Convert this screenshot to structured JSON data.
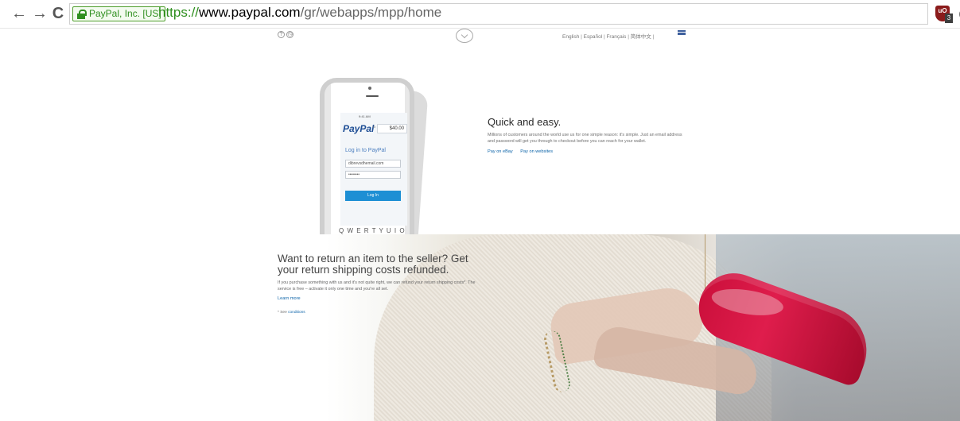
{
  "browser": {
    "back_symbol": "←",
    "forward_symbol": "→",
    "reload_symbol": "C",
    "ev_label": "PayPal, Inc. [US]",
    "url_proto": "https://",
    "url_host": "www.paypal.com",
    "url_path": "/gr/webapps/mpp/home",
    "ublock_label": "uO",
    "ublock_count": "3"
  },
  "top": {
    "help": "?",
    "clock": "◷",
    "languages": [
      "English",
      "Español",
      "Français",
      "简体中文"
    ]
  },
  "phone": {
    "time": "9:41 AM",
    "logo": "PayPal",
    "to": "To",
    "amount": "$40.00",
    "login_title": "Log in to PayPal",
    "email": "dibrevsdhemail.com",
    "password": "••••••••",
    "login_button": "Log In",
    "keyboard": "Q W E R T Y U I O P"
  },
  "feature": {
    "title": "Quick and easy.",
    "text": "Millions of customers around the world use us for one simple reason: it's simple. Just an email address and password will get you through to checkout before you can reach for your wallet.",
    "links": [
      "Pay on eBay",
      "Pay on websites"
    ]
  },
  "hero": {
    "title": "Want to return an item to the seller? Get your return shipping costs refunded.",
    "text": "If you purchase something with us and it's not quite right, we can refund your return shipping costs*. The service is free – activate it only one time and you're all set.",
    "learn_more": "Learn more",
    "note_prefix": "* See",
    "note_link": "conditions"
  }
}
